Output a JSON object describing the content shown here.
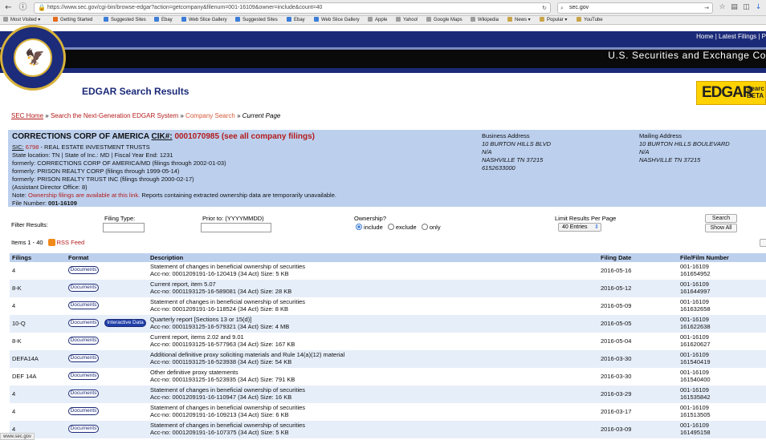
{
  "browser": {
    "url": "https://www.sec.gov/cgi-bin/browse-edgar?action=getcompany&filenum=001-16109&owner=include&count=40",
    "search": "sec.gov"
  },
  "bookmarks": [
    "Most Visited",
    "Getting Started",
    "Suggested Sites",
    "Ebay",
    "Web Slice Gallery",
    "Suggested Sites",
    "Ebay",
    "Web Slice Gallery",
    "Apple",
    "Yahoo!",
    "Google Maps",
    "Wikipedia",
    "News",
    "Popular",
    "YouTube"
  ],
  "header": {
    "links": "Home | Latest Filings | P",
    "agency": "U.S. Securities and Exchange Co"
  },
  "page_title": "EDGAR Search Results",
  "beta": {
    "big": "EDGAR",
    "line1": "Searc",
    "line2": "BETA"
  },
  "breadcrumb": {
    "home": "SEC Home",
    "sep": "»",
    "next": "Search the Next-Generation EDGAR System",
    "company": "Company Search",
    "current": "Current Page"
  },
  "company": {
    "name": "CORRECTIONS CORP OF AMERICA",
    "cik_label": "CIK#:",
    "cik": "0001070985 (see all company filings)",
    "sic_label": "SIC:",
    "sic_code": "6798",
    "sic_desc": "- REAL ESTATE INVESTMENT TRUSTS",
    "state_line": "State location: TN | State of Inc.: MD | Fiscal Year End: 1231",
    "former1": "formerly: CORRECTIONS CORP OF AMERICA/MD (filings through 2002-01-03)",
    "former2": "formerly: PRISON REALTY CORP (filings through 1999-05-14)",
    "former3": "formerly: PRISON REALTY TRUST INC (filings through 2000-02-17)",
    "office": "(Assistant Director Office: 8)",
    "note_pre": "Note: ",
    "note_link": "Ownership filings are available at this link.",
    "note_post": " Reports containing extracted ownership data are temporarily unavailable.",
    "file_label": "File Number:",
    "file_number": "001-16109"
  },
  "business": {
    "title": "Business Address",
    "l1": "10 BURTON HILLS BLVD",
    "l2": "N/A",
    "l3": "NASHVILLE TN 37215",
    "l4": "6152633000"
  },
  "mailing": {
    "title": "Mailing Address",
    "l1": "10 BURTON HILLS BOULEVARD",
    "l2": "N/A",
    "l3": "NASHVILLE TN 37215"
  },
  "filter": {
    "label": "Filter Results:",
    "type_label": "Filing Type:",
    "prior_label": "Prior to: (YYYYMMDD)",
    "own_label": "Ownership?",
    "opt_include": "include",
    "opt_exclude": "exclude",
    "opt_only": "only",
    "limit_label": "Limit Results Per Page",
    "limit_value": "40 Entries",
    "search_btn": "Search",
    "showall_btn": "Show All"
  },
  "items": {
    "range": "Items 1 - 40",
    "rss": "RSS Feed"
  },
  "table": {
    "headers": [
      "Filings",
      "Format",
      "Description",
      "Filing Date",
      "File/Film Number"
    ],
    "doc_label": "Documents",
    "interactive_label": "Interactive Data",
    "rows": [
      {
        "filing": "4",
        "d1": "Statement of changes in beneficial ownership of securities",
        "d2": "Acc-no: 0001209191-16-120419 (34 Act)  Size: 5 KB",
        "date": "2016-05-16",
        "file": "001-16109",
        "film": "161654952"
      },
      {
        "filing": "8-K",
        "d1": "Current report, item 5.07",
        "d2": "Acc-no: 0001193125-16-589081 (34 Act)  Size: 28 KB",
        "date": "2016-05-12",
        "file": "001-16109",
        "film": "161644997"
      },
      {
        "filing": "4",
        "d1": "Statement of changes in beneficial ownership of securities",
        "d2": "Acc-no: 0001209191-16-118524 (34 Act)  Size: 8 KB",
        "date": "2016-05-09",
        "file": "001-16109",
        "film": "161632658"
      },
      {
        "filing": "10-Q",
        "d1": "Quarterly report [Sections 13 or 15(d)]",
        "d2": "Acc-no: 0001193125-16-579321 (34 Act)  Size: 4 MB",
        "date": "2016-05-05",
        "file": "001-16109",
        "film": "161622638"
      },
      {
        "filing": "8-K",
        "d1": "Current report, items 2.02 and 9.01",
        "d2": "Acc-no: 0001193125-16-577963 (34 Act)  Size: 167 KB",
        "date": "2016-05-04",
        "file": "001-16109",
        "film": "161620627"
      },
      {
        "filing": "DEFA14A",
        "d1": "Additional definitive proxy soliciting materials and Rule 14(a)(12) material",
        "d2": "Acc-no: 0001193125-16-523938 (34 Act)  Size: 54 KB",
        "date": "2016-03-30",
        "file": "001-16109",
        "film": "161540419"
      },
      {
        "filing": "DEF 14A",
        "d1": "Other definitive proxy statements",
        "d2": "Acc-no: 0001193125-16-523935 (34 Act)  Size: 791 KB",
        "date": "2016-03-30",
        "file": "001-16109",
        "film": "161540400"
      },
      {
        "filing": "4",
        "d1": "Statement of changes in beneficial ownership of securities",
        "d2": "Acc-no: 0001209191-16-110947 (34 Act)  Size: 16 KB",
        "date": "2016-03-29",
        "file": "001-16109",
        "film": "161535842"
      },
      {
        "filing": "4",
        "d1": "Statement of changes in beneficial ownership of securities",
        "d2": "Acc-no: 0001209191-16-109213 (34 Act)  Size: 6 KB",
        "date": "2016-03-17",
        "file": "001-16109",
        "film": "161513505"
      },
      {
        "filing": "4",
        "d1": "Statement of changes in beneficial ownership of securities",
        "d2": "Acc-no: 0001209191-16-107375 (34 Act)  Size: 5 KB",
        "date": "2016-03-09",
        "file": "001-16109",
        "film": "161495158"
      }
    ]
  },
  "status": "www.sec.gov",
  "colors": {
    "navy": "#1b2a78",
    "link_red": "#b31b1b",
    "box_blue": "#bcd0ee",
    "beta_yellow": "#ffd200"
  }
}
